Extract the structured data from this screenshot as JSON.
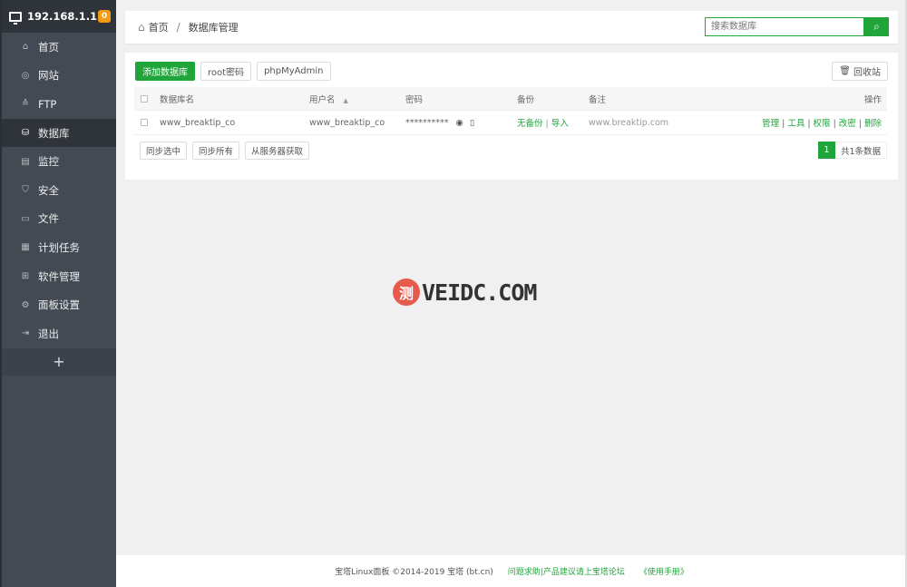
{
  "sidebar": {
    "ip": "192.168.1.1",
    "badge": "0",
    "items": [
      {
        "label": "首页",
        "icon": "home-icon"
      },
      {
        "label": "网站",
        "icon": "globe-icon"
      },
      {
        "label": "FTP",
        "icon": "ftp-icon"
      },
      {
        "label": "数据库",
        "icon": "database-icon"
      },
      {
        "label": "监控",
        "icon": "monitor-icon"
      },
      {
        "label": "安全",
        "icon": "shield-icon"
      },
      {
        "label": "文件",
        "icon": "folder-icon"
      },
      {
        "label": "计划任务",
        "icon": "calendar-icon"
      },
      {
        "label": "软件管理",
        "icon": "apps-icon"
      },
      {
        "label": "面板设置",
        "icon": "settings-icon"
      },
      {
        "label": "退出",
        "icon": "logout-icon"
      }
    ],
    "active_index": 3,
    "plus": "+"
  },
  "breadcrumb": {
    "home": "首页",
    "sep": "/",
    "current": "数据库管理"
  },
  "search": {
    "placeholder": "搜索数据库"
  },
  "toolbar": {
    "add": "添加数据库",
    "root_pwd": "root密码",
    "phpmyadmin": "phpMyAdmin",
    "recycle": "回收站"
  },
  "table": {
    "headers": {
      "name": "数据库名",
      "user": "用户名",
      "sort": "▲",
      "password": "密码",
      "backup": "备份",
      "note": "备注",
      "ops": "操作"
    },
    "rows": [
      {
        "name": "www_breaktip_co",
        "user": "www_breaktip_co",
        "password": "**********",
        "backup_none": "无备份",
        "backup_sep": "|",
        "import": "导入",
        "note": "www.breaktip.com",
        "ops": [
          "管理",
          "工具",
          "权限",
          "改密",
          "删除"
        ]
      }
    ]
  },
  "sync": {
    "selected": "同步选中",
    "all": "同步所有",
    "from_server": "从服务器获取"
  },
  "pager": {
    "current": "1",
    "info": "共1条数据"
  },
  "watermark": {
    "char": "测",
    "text": "VEIDC.COM"
  },
  "footer": {
    "copyright": "宝塔Linux面板 ©2014-2019 宝塔 (bt.cn)",
    "forum": "问题求助|产品建议请上宝塔论坛",
    "manual": "《使用手册》"
  },
  "colors": {
    "accent": "#20a53a",
    "sidebar": "#434a54",
    "sidebar_active": "#2f343b",
    "badge": "#f39c12",
    "watermark": "#e75b4d"
  }
}
